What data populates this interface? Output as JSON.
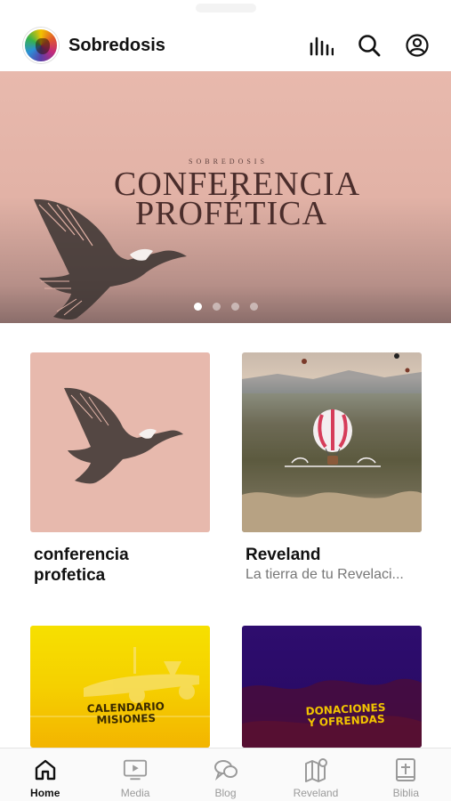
{
  "header": {
    "title": "Sobredosis",
    "icons": [
      "equalizer-icon",
      "search-icon",
      "profile-icon"
    ]
  },
  "hero": {
    "brand_small": "SOBREDOSIS",
    "title_line1": "CONFERENCIA",
    "title_line2": "PROFÉTICA",
    "slides_total": 4,
    "active_slide": 1
  },
  "cards": [
    {
      "title_line1": "conferencia",
      "title_line2": "profetica",
      "subtitle": ""
    },
    {
      "title_line1": "Reveland",
      "title_line2": "",
      "subtitle": "La tierra de tu Revelaci..."
    },
    {
      "art_line1": "CALENDARIO",
      "art_line2": "MISIONES"
    },
    {
      "art_line1": "DONACIONES",
      "art_line2": "Y OFRENDAS"
    }
  ],
  "tabs": [
    {
      "label": "Home",
      "icon": "home-icon",
      "active": true
    },
    {
      "label": "Media",
      "icon": "media-icon",
      "active": false
    },
    {
      "label": "Blog",
      "icon": "blog-icon",
      "active": false
    },
    {
      "label": "Reveland",
      "icon": "map-icon",
      "active": false
    },
    {
      "label": "Biblia",
      "icon": "bible-icon",
      "active": false
    }
  ],
  "colors": {
    "hero_bg": "#e2b2a6",
    "active_tab": "#111111",
    "inactive_tab": "#9a9a9a"
  }
}
